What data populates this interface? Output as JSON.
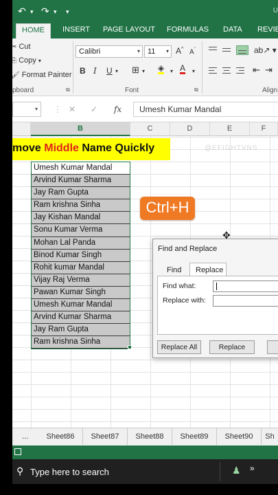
{
  "app": {
    "title_fragment": "U"
  },
  "qat": {
    "undo": "↶",
    "redo": "↷"
  },
  "ribbon": {
    "tabs": [
      "HOME",
      "INSERT",
      "PAGE LAYOUT",
      "FORMULAS",
      "DATA",
      "REVIEW"
    ],
    "clipboard": {
      "cut": "Cut",
      "copy": "Copy",
      "format_painter": "Format Painter",
      "label": "pboard"
    },
    "font": {
      "family": "Calibri",
      "size": "11",
      "label": "Font",
      "bold": "B",
      "italic": "I",
      "underline": "U",
      "grow": "A",
      "shrink": "A",
      "color_a": "A"
    },
    "alignment": {
      "label": "Align"
    }
  },
  "formula_bar": {
    "content": "Umesh Kumar Mandal",
    "cancel": "✕",
    "enter": "✓",
    "fx": "fx"
  },
  "columns": [
    "B",
    "C",
    "D",
    "E",
    "F"
  ],
  "sheet": {
    "banner_left": "move ",
    "banner_highlight": "Middle",
    "banner_right": " Name Quickly",
    "watermark": "@EFIGHTVNS",
    "names": [
      "Umesh Kumar Mandal",
      "Arvind Kumar Sharma",
      "Jay Ram Gupta",
      "Ram krishna Sinha",
      "Jay Kishan Mandal",
      "Sonu Kumar Verma",
      "Mohan Lal Panda",
      "Binod Kumar Singh",
      "Rohit kumar Mandal",
      "Vijay Raj Verma",
      "Pawan Kumar Singh",
      "Umesh Kumar Mandal",
      "Arvind Kumar Sharma",
      "Jay Ram Gupta",
      "Ram krishna Sinha"
    ]
  },
  "shortcut": "Ctrl+H",
  "dialog": {
    "title": "Find and Replace",
    "tab_find": "Find",
    "tab_replace": "Replace",
    "find_label": "Find what:",
    "replace_label": "Replace with:",
    "find_value": "",
    "replace_value": "",
    "btn_replace_all": "Replace All",
    "btn_replace": "Replace"
  },
  "sheet_tabs": [
    "...",
    "Sheet86",
    "Sheet87",
    "Sheet88",
    "Sheet89",
    "Sheet90",
    "Sh"
  ],
  "taskbar": {
    "search_placeholder": "Type here to search",
    "chevron": "»"
  },
  "colors": {
    "excel_green": "#217346",
    "banner_yellow": "#ffff00",
    "banner_red": "#e0241b",
    "shortcut_orange": "#f07a24"
  }
}
